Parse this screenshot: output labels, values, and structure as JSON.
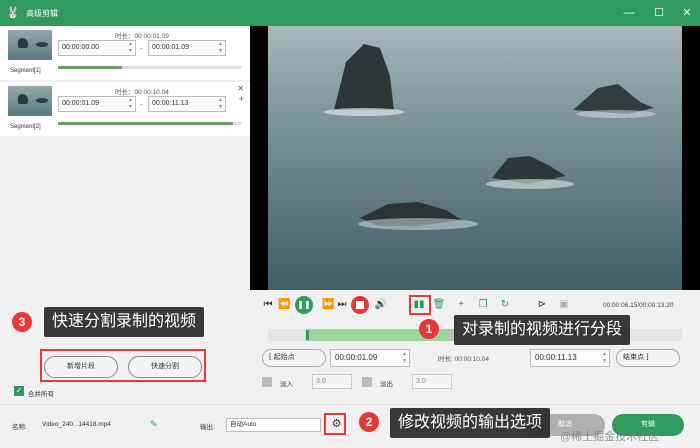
{
  "window": {
    "title": "高级剪辑",
    "minimize": "—",
    "maximize": "☐",
    "close": "✕"
  },
  "segments": [
    {
      "label": "Segment[1]",
      "duration_label": "时长：00:00:01.09",
      "start": "00:00:00.00",
      "end": "00:00:01.09",
      "progress": 0.35
    },
    {
      "label": "Segment[2]",
      "duration_label": "时长：00:00:10.04",
      "start": "00:00:01.09",
      "end": "00:00:11.13",
      "progress": 0.95
    }
  ],
  "segment_actions": {
    "close": "✕",
    "add": "+"
  },
  "player": {
    "time": "00:00:06.15/00:00:13.20"
  },
  "range": {
    "start_btn": "起始点",
    "start_value": "00:00:01.09",
    "duration_label": "时长: 00:00:10.04",
    "end_value": "00:00:11.13",
    "end_btn": "结束点"
  },
  "fade": {
    "in_label": "淡入",
    "in_value": "3.0",
    "out_label": "淡出",
    "out_value": "3.0"
  },
  "left_actions": {
    "add_segment": "新增片段",
    "quick_split": "快速分割",
    "merge_all": "合并所有"
  },
  "bottom": {
    "name_label": "名称:",
    "file_name": "Video_240...14418.mp4",
    "output_label": "输出:",
    "output_value": "自动Auto",
    "cancel_btn": "取消",
    "cut_btn": "剪辑"
  },
  "annotations": [
    {
      "num": "1",
      "text": "对录制的视频进行分段"
    },
    {
      "num": "2",
      "text": "修改视频的输出选项"
    },
    {
      "num": "3",
      "text": "快速分割录制的视频"
    }
  ],
  "watermark": "@稀土掘金技术社区",
  "colors": {
    "accent": "#2e9a5e",
    "annotation": "#e53935"
  }
}
